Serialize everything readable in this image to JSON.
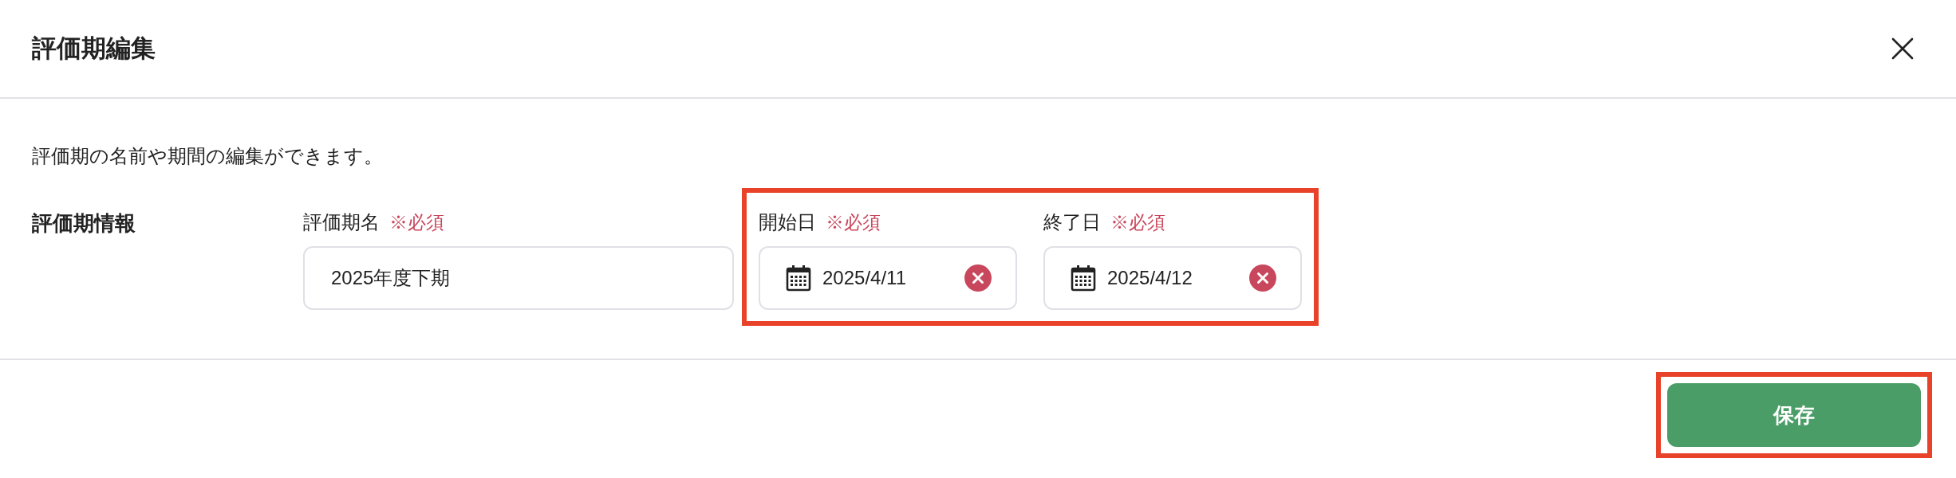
{
  "dialog": {
    "title": "評価期編集",
    "description": "評価期の名前や期間の編集ができます。",
    "section": {
      "label": "評価期情報",
      "groups": [
        {
          "highlighted": false,
          "fields": [
            {
              "kind": "text",
              "label": "評価期名",
              "required": "※必須",
              "value": "2025年度下期"
            }
          ]
        },
        {
          "highlighted": true,
          "fields": [
            {
              "kind": "date",
              "label": "開始日",
              "required": "※必須",
              "value": "2025/4/11"
            },
            {
              "kind": "date",
              "label": "終了日",
              "required": "※必須",
              "value": "2025/4/12"
            }
          ]
        }
      ]
    },
    "footer": {
      "buttons": [
        {
          "label": "保存",
          "highlighted": true
        }
      ]
    }
  }
}
